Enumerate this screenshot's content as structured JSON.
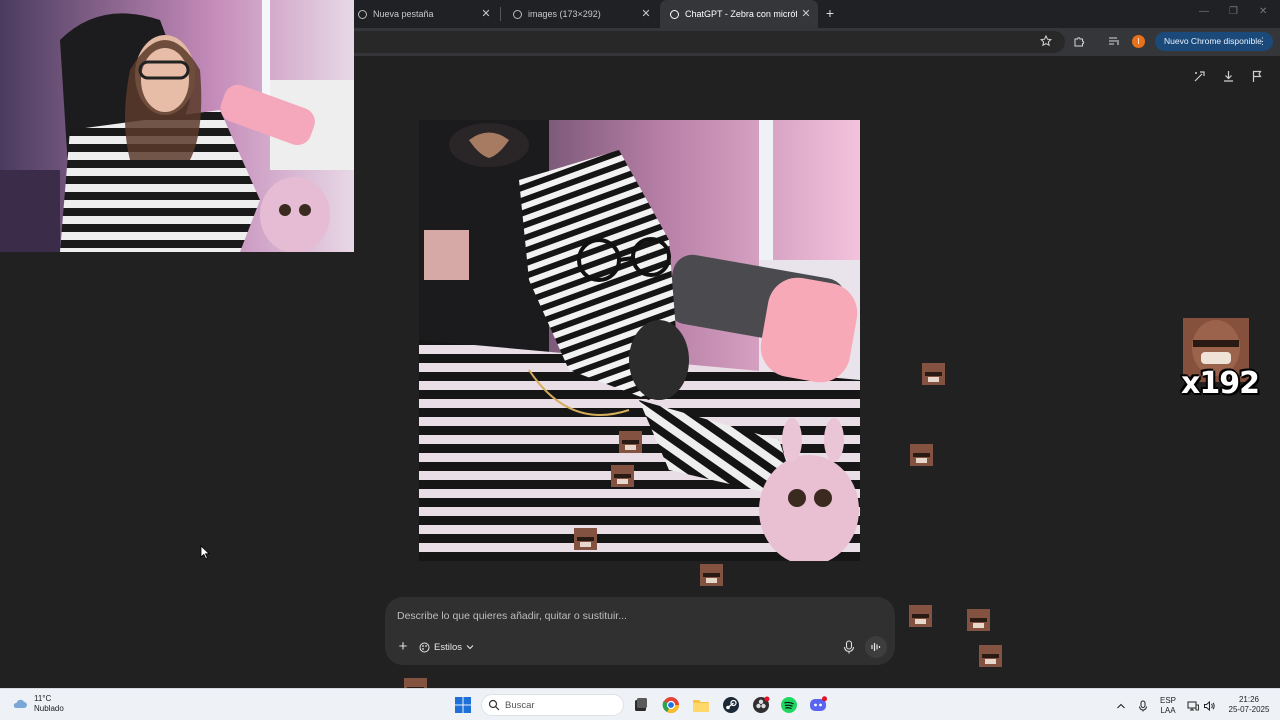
{
  "browser": {
    "tabs": [
      {
        "label": "Nueva pestaña",
        "active": false
      },
      {
        "label": "images (173×292)",
        "active": false
      },
      {
        "label": "ChatGPT - Zebra con micrófono",
        "active": true
      }
    ],
    "new_tab_symbol": "+",
    "profile_initial": "I",
    "update_label": "Nuevo Chrome disponible",
    "icons": [
      "star-icon",
      "extensions-icon",
      "media-control-icon",
      "more-vert-icon"
    ]
  },
  "chatgpt": {
    "header_icons": [
      "select-area-icon",
      "download-icon",
      "flag-icon"
    ],
    "image_subject": "zebra",
    "composer": {
      "placeholder": "Describe lo que quieres añadir, quitar o sustituir...",
      "styles_label": "Estilos"
    }
  },
  "overlay": {
    "emote_counter": "x192"
  },
  "taskbar": {
    "weather_temp": "11°C",
    "weather_desc": "Nublado",
    "search_placeholder": "Buscar",
    "language_line1": "ESP",
    "language_line2": "LAA",
    "time": "21:26",
    "date": "25-07-2025"
  },
  "colors": {
    "page_bg": "#212121",
    "composer_bg": "#303030",
    "update_pill": "#1b4a7a",
    "taskbar_bg": "#eef2f7"
  }
}
